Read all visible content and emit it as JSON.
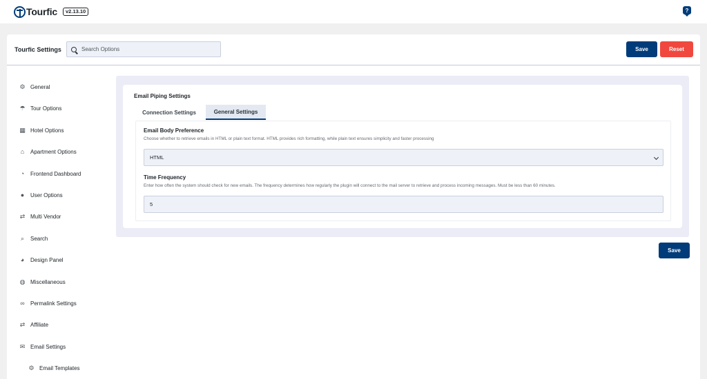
{
  "app": {
    "logo_text": "Tourfic",
    "version": "v2.13.10",
    "help_icon": "question-chat-icon"
  },
  "header": {
    "title": "Tourfic Settings",
    "search_placeholder": "Search Options",
    "save_label": "Save",
    "reset_label": "Reset"
  },
  "sidebar": {
    "items": [
      {
        "label": "General",
        "icon": "gear-icon"
      },
      {
        "label": "Tour Options",
        "icon": "umbrella-icon"
      },
      {
        "label": "Hotel Options",
        "icon": "building-icon"
      },
      {
        "label": "Apartment Options",
        "icon": "home-icon"
      },
      {
        "label": "Frontend Dashboard",
        "icon": "dashboard-icon"
      },
      {
        "label": "User Options",
        "icon": "user-icon"
      },
      {
        "label": "Multi Vendor",
        "icon": "handshake-icon"
      },
      {
        "label": "Search",
        "icon": "search-icon"
      },
      {
        "label": "Design Panel",
        "icon": "palette-icon"
      },
      {
        "label": "Miscellaneous",
        "icon": "globe-icon"
      },
      {
        "label": "Permalink Settings",
        "icon": "link-icon"
      },
      {
        "label": "Affiliate",
        "icon": "handshake-icon"
      },
      {
        "label": "Email Settings",
        "icon": "envelope-icon"
      },
      {
        "label": "Email Templates",
        "icon": "cogs-icon"
      }
    ]
  },
  "content": {
    "section_title": "Email Piping Settings",
    "tabs": [
      {
        "label": "Connection Settings"
      },
      {
        "label": "General Settings",
        "active": true
      }
    ],
    "fields": {
      "body_preference": {
        "label": "Email Body Preference",
        "description": "Choose whether to retrieve emails in HTML or plain text format. HTML provides rich formatting, while plain text ensures simplicity and faster processing",
        "value": "HTML"
      },
      "time_frequency": {
        "label": "Time Frequency",
        "description": "Enter how often the system should check for new emails. The frequency determines how regularly the plugin will connect to the mail server to retrieve and process incoming messages. Must be less than 60 minutes.",
        "value": "5"
      }
    },
    "save_label": "Save"
  },
  "colors": {
    "primary": "#003c79",
    "danger": "#f0483e",
    "content_bg": "#ebecf6"
  }
}
